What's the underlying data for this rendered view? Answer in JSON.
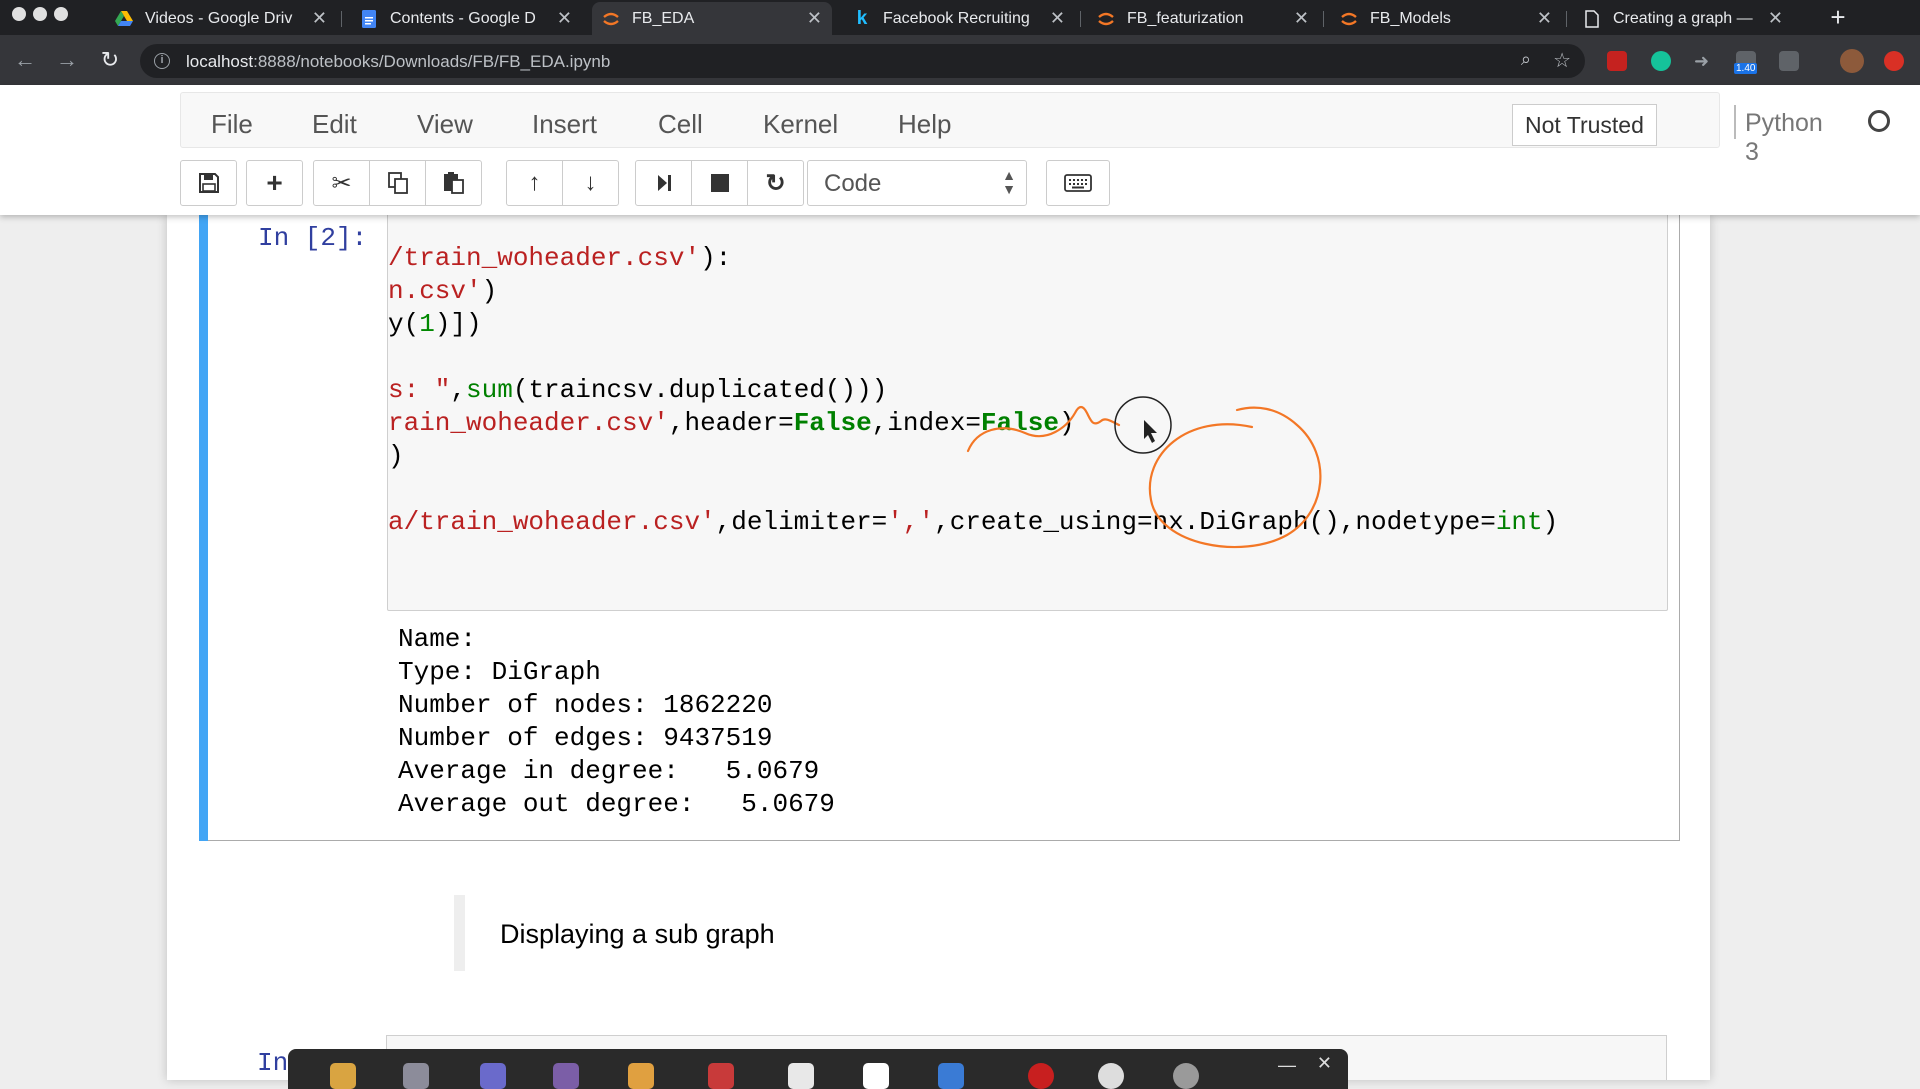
{
  "browser": {
    "tabs": [
      {
        "title": "Videos - Google Driv",
        "icon": "google-drive-icon",
        "icon_color": "#fbbc04"
      },
      {
        "title": "Contents - Google D",
        "icon": "google-docs-icon",
        "icon_color": "#4285f4"
      },
      {
        "title": "FB_EDA",
        "icon": "jupyter-icon",
        "icon_color": "#f37726",
        "active": true
      },
      {
        "title": "Facebook Recruiting",
        "icon": "kaggle-icon",
        "icon_color": "#20beff"
      },
      {
        "title": "FB_featurization",
        "icon": "jupyter-icon",
        "icon_color": "#f37726"
      },
      {
        "title": "FB_Models",
        "icon": "jupyter-icon",
        "icon_color": "#f37726"
      },
      {
        "title": "Creating a graph — ",
        "icon": "document-icon",
        "icon_color": "#e8eaed"
      }
    ],
    "url_host": "localhost",
    "url_path": ":8888/notebooks/Downloads/FB/FB_EDA.ipynb",
    "extension_badge": "1.40"
  },
  "jupyter": {
    "menu": [
      "File",
      "Edit",
      "View",
      "Insert",
      "Cell",
      "Kernel",
      "Help"
    ],
    "trust_label": "Not Trusted",
    "kernel_name": "Python 3",
    "cell_type": "Code"
  },
  "cell": {
    "prompt": "In [2]:",
    "code_lines": [
      [
        {
          "t": "/train_woheader.csv'",
          "c": "s"
        },
        {
          "t": "):"
        }
      ],
      [
        {
          "t": "n.csv'",
          "c": "s"
        },
        {
          "t": ")"
        }
      ],
      [
        {
          "t": "y("
        },
        {
          "t": "1",
          "c": "n"
        },
        {
          "t": ")])"
        }
      ],
      [],
      [
        {
          "t": "s: \"",
          "c": "s"
        },
        {
          "t": ","
        },
        {
          "t": "sum",
          "c": "b"
        },
        {
          "t": "(traincsv.duplicated()))"
        }
      ],
      [
        {
          "t": "rain_woheader.csv'",
          "c": "s"
        },
        {
          "t": ",header="
        },
        {
          "t": "False",
          "c": "k"
        },
        {
          "t": ",index="
        },
        {
          "t": "False",
          "c": "k"
        },
        {
          "t": ")"
        }
      ],
      [
        {
          "t": ")"
        }
      ],
      [],
      [
        {
          "t": "a/train_woheader.csv'",
          "c": "s"
        },
        {
          "t": ",delimiter="
        },
        {
          "t": "','",
          "c": "s"
        },
        {
          "t": ",create_using=nx.DiGraph(),nodetype="
        },
        {
          "t": "int",
          "c": "b"
        },
        {
          "t": ")"
        }
      ]
    ],
    "output_lines": [
      "Name: ",
      "Type: DiGraph",
      "Number of nodes: 1862220",
      "Number of edges: 9437519",
      "Average in degree:   5.0679",
      "Average out degree:   5.0679"
    ]
  },
  "markdown": {
    "text": "Displaying a sub graph"
  },
  "next_cell": {
    "prompt": "In"
  },
  "colors": {
    "accent_blue": "#42a5f5",
    "annotation_orange": "#f37726",
    "prompt_blue": "#303f9f"
  }
}
